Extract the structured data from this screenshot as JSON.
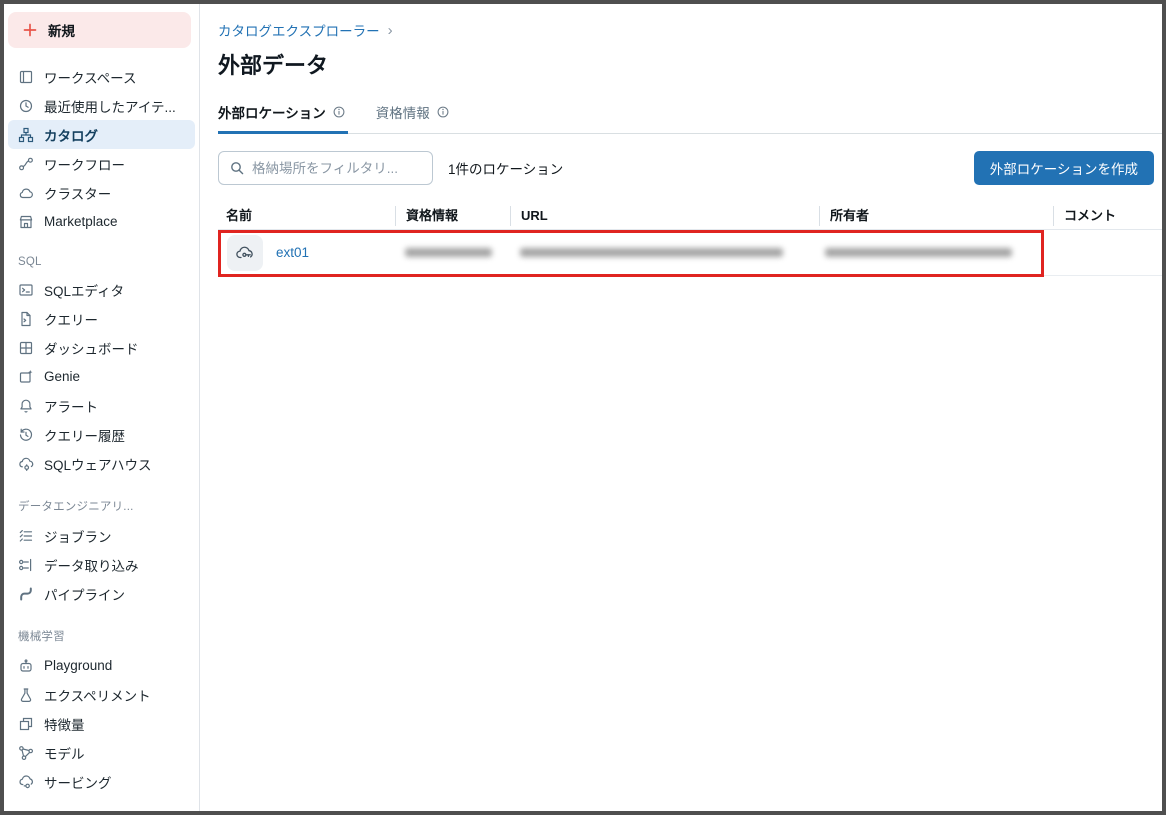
{
  "sidebar": {
    "new_button": {
      "label": "新規",
      "icon": "plus-icon"
    },
    "sections": [
      {
        "header": null,
        "items": [
          {
            "label": "ワークスペース",
            "icon": "workspace-icon",
            "active": false
          },
          {
            "label": "最近使用したアイテ...",
            "icon": "clock-icon",
            "active": false
          },
          {
            "label": "カタログ",
            "icon": "catalog-icon",
            "active": true
          },
          {
            "label": "ワークフロー",
            "icon": "workflow-icon",
            "active": false
          },
          {
            "label": "クラスター",
            "icon": "cloud-icon",
            "active": false
          },
          {
            "label": "Marketplace",
            "icon": "storefront-icon",
            "active": false
          }
        ]
      },
      {
        "header": "SQL",
        "items": [
          {
            "label": "SQLエディタ",
            "icon": "sql-editor-icon",
            "active": false
          },
          {
            "label": "クエリー",
            "icon": "query-file-icon",
            "active": false
          },
          {
            "label": "ダッシュボード",
            "icon": "dashboard-icon",
            "active": false
          },
          {
            "label": "Genie",
            "icon": "genie-icon",
            "active": false
          },
          {
            "label": "アラート",
            "icon": "bell-icon",
            "active": false
          },
          {
            "label": "クエリー履歴",
            "icon": "history-icon",
            "active": false
          },
          {
            "label": "SQLウェアハウス",
            "icon": "warehouse-icon",
            "active": false
          }
        ]
      },
      {
        "header": "データエンジニアリ...",
        "items": [
          {
            "label": "ジョブラン",
            "icon": "job-runs-icon",
            "active": false
          },
          {
            "label": "データ取り込み",
            "icon": "ingestion-icon",
            "active": false
          },
          {
            "label": "パイプライン",
            "icon": "pipeline-icon",
            "active": false
          }
        ]
      },
      {
        "header": "機械学習",
        "items": [
          {
            "label": "Playground",
            "icon": "robot-icon",
            "active": false
          },
          {
            "label": "エクスペリメント",
            "icon": "flask-icon",
            "active": false
          },
          {
            "label": "特徴量",
            "icon": "feature-store-icon",
            "active": false
          },
          {
            "label": "モデル",
            "icon": "model-icon",
            "active": false
          },
          {
            "label": "サービング",
            "icon": "serving-icon",
            "active": false
          }
        ]
      }
    ]
  },
  "main": {
    "breadcrumb": {
      "label": "カタログエクスプローラー",
      "chevron": "›"
    },
    "title": "外部データ",
    "tabs": [
      {
        "label": "外部ロケーション",
        "info_icon": "info-icon",
        "active": true
      },
      {
        "label": "資格情報",
        "info_icon": "info-icon",
        "active": false
      }
    ],
    "filter": {
      "placeholder": "格納場所をフィルタリ...",
      "count_text": "1件のロケーション"
    },
    "create_button_label": "外部ロケーションを作成",
    "table": {
      "columns": [
        "名前",
        "資格情報",
        "URL",
        "所有者",
        "コメント"
      ],
      "column_keys": [
        "name",
        "credential",
        "url",
        "owner",
        "comment"
      ],
      "rows": [
        {
          "name": "ext01",
          "icon": "external-location-cloud-icon",
          "credential_redacted": true,
          "url_redacted": true,
          "owner_redacted": true,
          "comment": ""
        }
      ]
    }
  },
  "colors": {
    "accent_blue": "#2272b4",
    "active_nav_bg": "#e4eef9",
    "new_button_bg": "#fbe9e9",
    "new_button_red": "#e8554a",
    "highlight_red": "#e02420",
    "frame_border": "#4f4f4f"
  }
}
